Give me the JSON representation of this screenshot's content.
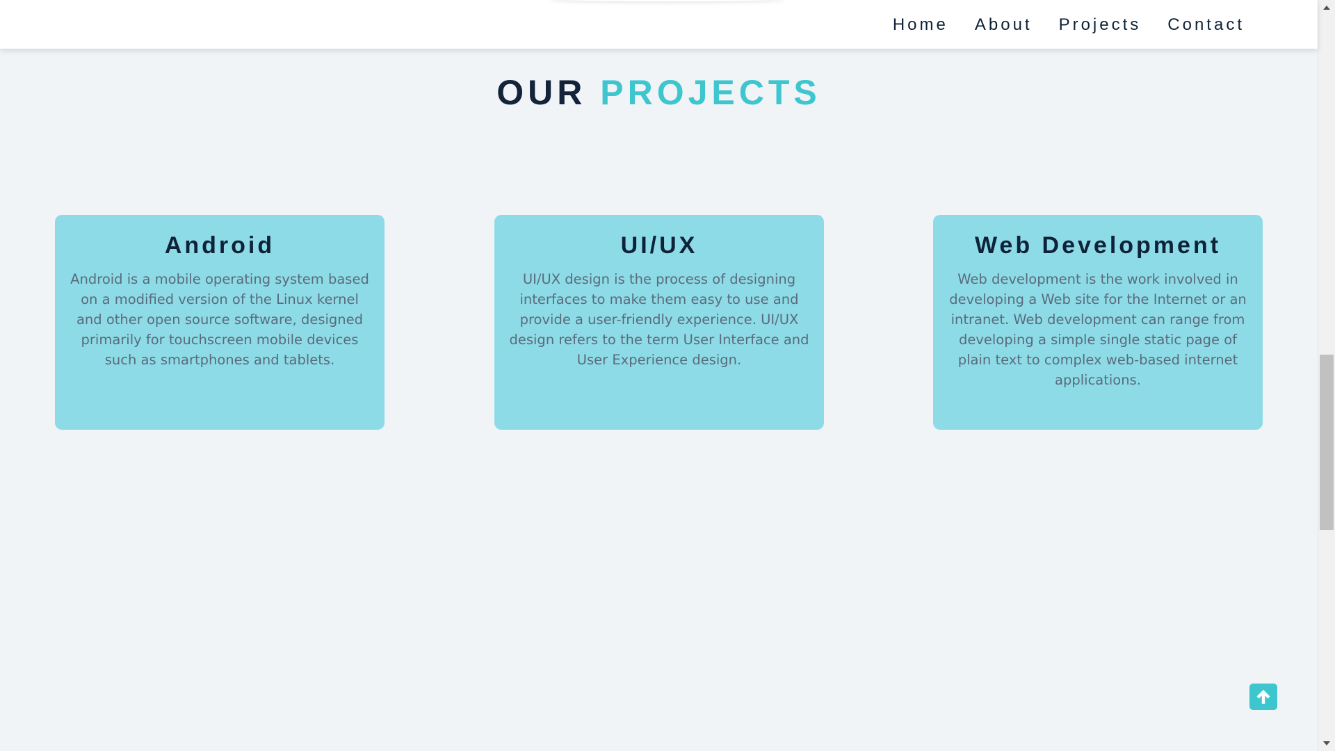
{
  "nav": {
    "items": [
      {
        "label": "Home"
      },
      {
        "label": "About"
      },
      {
        "label": "Projects"
      },
      {
        "label": "Contact"
      }
    ]
  },
  "section": {
    "title_part1": "OUR",
    "title_part2": "PROJECTS"
  },
  "cards": [
    {
      "title": "Android",
      "description": "Android is a mobile operating system based on a modified version of the Linux kernel and other open source software, designed primarily for touchscreen mobile devices such as smartphones and tablets."
    },
    {
      "title": "UI/UX",
      "description": "UI/UX design is the process of designing interfaces to make them easy to use and provide a user-friendly experience. UI/UX design refers to the term User Interface and User Experience design."
    },
    {
      "title": "Web Development",
      "description": "Web development is the work involved in developing a Web site for the Internet or an intranet. Web development can range from developing a simple single static page of plain text to complex web-based internet applications."
    }
  ],
  "back_to_top": {
    "icon": "arrow-up-icon"
  },
  "colors": {
    "accent": "#3ec6cf",
    "card_bg": "#8ddbe7",
    "heading_dark": "#12233a",
    "page_bg": "#f0f4f7"
  }
}
